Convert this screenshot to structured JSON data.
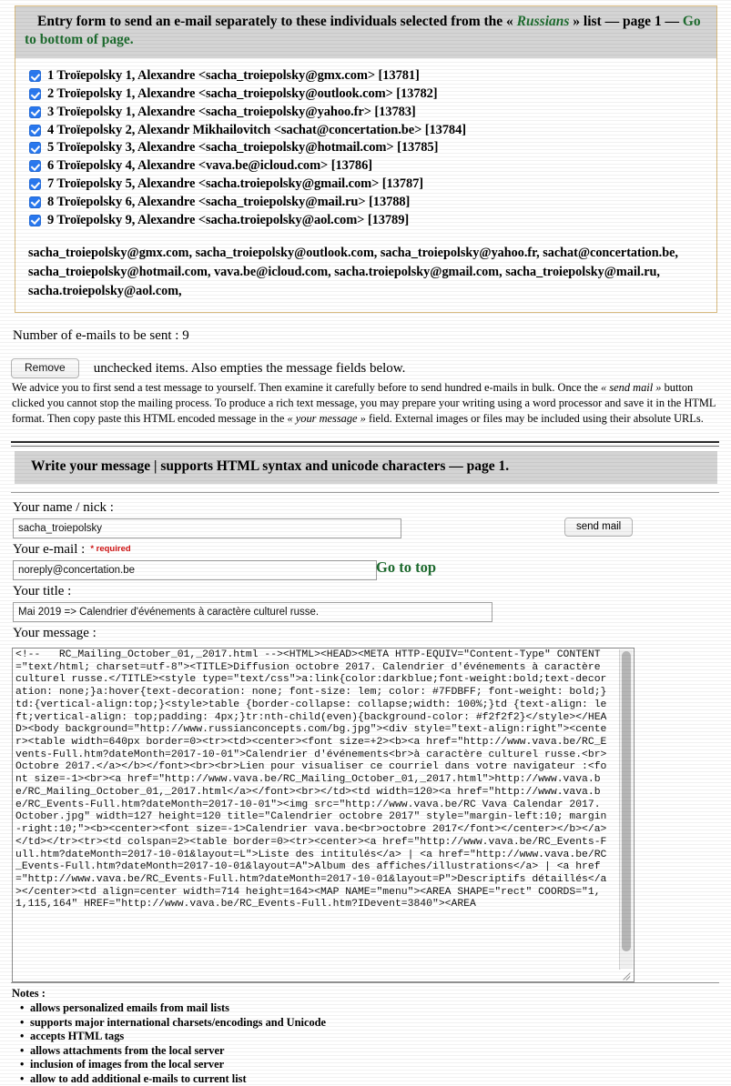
{
  "header": {
    "intro": "Entry form to send an e-mail separately to these individuals selected from the",
    "guillemet_open": "«",
    "list_name": "Russians",
    "guillemet_close": "»",
    "after_list": "list",
    "dash1": "—",
    "page_label": "page 1",
    "dash2": "—",
    "bottom_link": "Go to bottom of page."
  },
  "recipients": [
    {
      "checked": true,
      "label": "1 Troïepolsky 1, Alexandre <sacha_troiepolsky@gmx.com> [13781]"
    },
    {
      "checked": true,
      "label": "2 Troïepolsky 1, Alexandre <sacha_troiepolsky@outlook.com> [13782]"
    },
    {
      "checked": true,
      "label": "3 Troïepolsky 1, Alexandre <sacha_troiepolsky@yahoo.fr> [13783]"
    },
    {
      "checked": true,
      "label": "4 Troïepolsky 2, Alexandr Mikhailovitch <sachat@concertation.be> [13784]"
    },
    {
      "checked": true,
      "label": "5 Troïepolsky 3, Alexandre <sacha_troiepolsky@hotmail.com> [13785]"
    },
    {
      "checked": true,
      "label": "6 Troïepolsky 4, Alexandre <vava.be@icloud.com> [13786]"
    },
    {
      "checked": true,
      "label": "7 Troïepolsky 5, Alexandre <sacha.troiepolsky@gmail.com> [13787]"
    },
    {
      "checked": true,
      "label": "8 Troïepolsky 6, Alexandre <sacha_troiepolsky@mail.ru> [13788]"
    },
    {
      "checked": true,
      "label": "9 Troïepolsky 9, Alexandre <sacha.troiepolsky@aol.com> [13789]"
    }
  ],
  "email_recap": "sacha_troiepolsky@gmx.com, sacha_troiepolsky@outlook.com, sacha_troiepolsky@yahoo.fr, sachat@concertation.be, sacha_troiepolsky@hotmail.com, vava.be@icloud.com, sacha.troiepolsky@gmail.com, sacha_troiepolsky@mail.ru, sacha.troiepolsky@aol.com,",
  "count_line": "Number of e-mails to be sent : 9",
  "remove": {
    "button_label": "Remove",
    "after_text": "unchecked items. Also empties the message fields below."
  },
  "advice": {
    "part1": "We advice you to first send a test message to yourself. Then examine it carefully before to send hundred e-mails in bulk. Once the ",
    "em1": "« send mail »",
    "part2": " button clicked you cannot stop the mailing process. To produce a rich text message, you may prepare your writing using a word processor and save it in the HTML format. Then copy paste this HTML encoded message in the ",
    "em2": "« your message »",
    "part3": " field. External images or files may be included using their absolute URLs."
  },
  "section2_title": "Write your message | supports HTML syntax and unicode characters — page 1.",
  "form": {
    "name_label": "Your name / nick :",
    "name_value": "sacha_troiepolsky",
    "email_label": "Your e-mail :",
    "email_required": "* required",
    "email_value": "noreply@concertation.be",
    "title_label": "Your title :",
    "title_value": "Mai 2019 => Calendrier d'événements à caractère culturel russe.",
    "message_label": "Your message :",
    "send_button": "send mail",
    "go_to_top": "Go to top",
    "message_value": "<!--   RC_Mailing_October_01,_2017.html --><HTML><HEAD><META HTTP-EQUIV=\"Content-Type\" CONTENT=\"text/html; charset=utf-8\"><TITLE>Diffusion octobre 2017. Calendrier d'événements à caractère culturel russe.</TITLE><style type=\"text/css\">a:link{color:darkblue;font-weight:bold;text-decoration: none;}a:hover{text-decoration: none; font-size: lem; color: #7FDBFF; font-weight: bold;}td:{vertical-align:top;}<style>table {border-collapse: collapse;width: 100%;}td {text-align: left;vertical-align: top;padding: 4px;}tr:nth-child(even){background-color: #f2f2f2}</style></HEAD><body background=\"http://www.russianconcepts.com/bg.jpg\"><div style=\"text-align:right\"><center><table width=640px border=0><tr><td><center><font size=+2><b><a href=\"http://www.vava.be/RC_Events-Full.htm?dateMonth=2017-10-01\">Calendrier d'événements<br>à caractère culturel russe.<br>Octobre 2017.</a></b></font><br><br>Lien pour visualiser ce courriel dans votre navigateur :<font size=-1><br><a href=\"http://www.vava.be/RC_Mailing_October_01,_2017.html\">http://www.vava.be/RC_Mailing_October_01,_2017.html</a></font><br></td><td width=120><a href=\"http://www.vava.be/RC_Events-Full.htm?dateMonth=2017-10-01\"><img src=\"http://www.vava.be/RC Vava Calendar 2017. October.jpg\" width=127 height=120 title=\"Calendrier octobre 2017\" style=\"margin-left:10; margin-right:10;\"><b><center><font size=-1>Calendrier vava.be<br>octobre 2017</font></center></b></a></td></tr><tr><td colspan=2><table border=0><tr><center><a href=\"http://www.vava.be/RC_Events-Full.htm?dateMonth=2017-10-01&layout=L\">Liste des intitulés</a> | <a href=\"http://www.vava.be/RC_Events-Full.htm?dateMonth=2017-10-01&layout=A\">Album des affiches/illustrations</a> | <a href=\"http://www.vava.be/RC_Events-Full.htm?dateMonth=2017-10-01&layout=P\">Descriptifs détaillés</a></center><td align=center width=714 height=164><MAP NAME=\"menu\"><AREA SHAPE=\"rect\" COORDS=\"1,1,115,164\" HREF=\"http://www.vava.be/RC_Events-Full.htm?IDevent=3840\"><AREA"
  },
  "notes": {
    "title": "Notes :",
    "items": [
      "allows personalized emails from mail lists",
      "supports major international charsets/encodings and Unicode",
      "accepts HTML tags",
      "allows attachments from the local server",
      "inclusion of images from the local server",
      "allow to add additional e-mails to current list"
    ]
  },
  "colors": {
    "accent_green": "#1d6b2e",
    "header_gray": "#d4d4d4",
    "panel_border": "#d9bb80",
    "checkbox_blue": "#2a79f0",
    "required_red": "#d01414"
  }
}
